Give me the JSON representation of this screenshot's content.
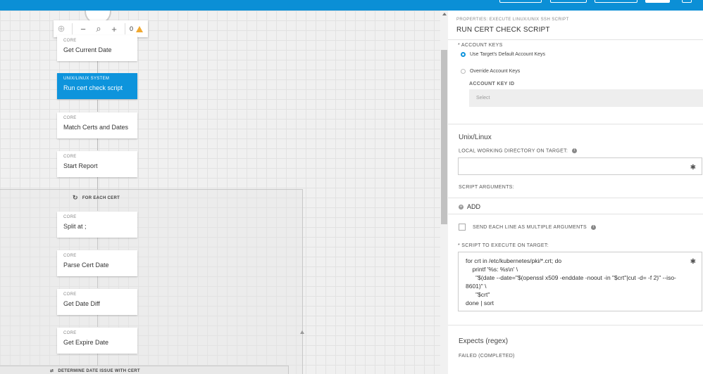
{
  "toolbar": {
    "zoom_out_icon": "minus-icon",
    "search_icon": "magnifier-icon",
    "zoom_in_icon": "plus-icon",
    "warning_count": "0"
  },
  "flow": {
    "nodes": [
      {
        "category": "CORE",
        "name": "Get Current Date"
      },
      {
        "category": "UNIX/LINUX SYSTEM",
        "name": "Run cert check script"
      },
      {
        "category": "CORE",
        "name": "Match Certs and Dates"
      },
      {
        "category": "CORE",
        "name": "Start Report"
      },
      {
        "category": "CORE",
        "name": "Split at ;"
      },
      {
        "category": "CORE",
        "name": "Parse Cert Date"
      },
      {
        "category": "CORE",
        "name": "Get Date Diff"
      },
      {
        "category": "CORE",
        "name": "Get Expire Date"
      }
    ],
    "loop_label": "FOR EACH CERT",
    "bottom_group_label": "DETERMINE DATE ISSUE WITH CERT"
  },
  "panel": {
    "sup": "PROPERTIES: EXECUTE LINUX/UNIX SSH SCRIPT",
    "title": "RUN CERT CHECK SCRIPT",
    "account_keys_label": "* ACCOUNT KEYS",
    "radio_default": "Use Target's Default Account Keys",
    "radio_override": "Override Account Keys",
    "account_key_id_label": "ACCOUNT KEY ID",
    "select_placeholder": "Select",
    "unix_section": "Unix/Linux",
    "local_dir_label": "LOCAL WORKING DIRECTORY ON TARGET:",
    "script_args_label": "SCRIPT ARGUMENTS:",
    "add_label": "ADD",
    "send_each_line_label": "SEND EACH LINE AS MULTIPLE ARGUMENTS",
    "script_label": "* SCRIPT TO EXECUTE ON TARGET:",
    "script_lines": [
      "for crt in /etc/kubernetes/pki/*.crt; do",
      "    printf '%s: %s\\n' \\",
      "      \"$(date --date=\"$(openssl x509 -enddate -noout -in \"$crt\"|cut -d= -f 2)\" --iso-",
      "8601)\" \\",
      "      \"$crt\"",
      "done | sort"
    ],
    "expects_section": "Expects (regex)",
    "failed_label": "FAILED (COMPLETED)"
  },
  "colors": {
    "brand": "#0b8fd6",
    "active_node": "#0e94dc",
    "warning": "#f0a830"
  }
}
